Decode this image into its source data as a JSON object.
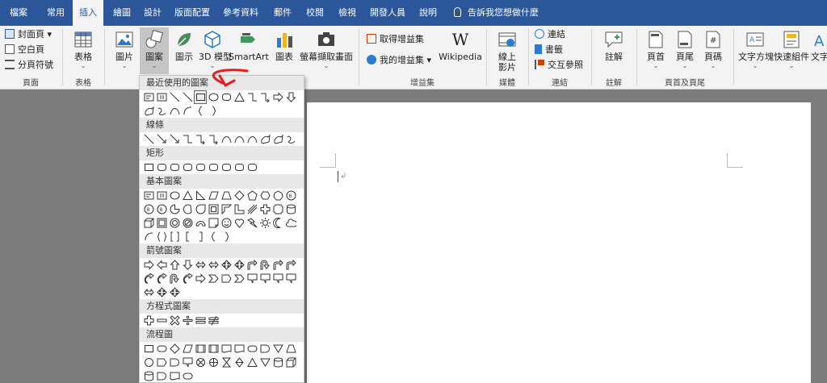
{
  "tabs": [
    "檔案",
    "常用",
    "插入",
    "繪圖",
    "設計",
    "版面配置",
    "參考資料",
    "郵件",
    "校閱",
    "檢視",
    "開發人員",
    "說明"
  ],
  "tell_me": "告訴我您想做什麼",
  "ribbon": {
    "pages": {
      "cover": "封面頁",
      "blank": "空白頁",
      "break": "分頁符號",
      "group": "頁面"
    },
    "table": {
      "label": "表格",
      "group": "表格"
    },
    "illustrations": {
      "picture": "圖片",
      "shapes": "圖案",
      "icons": "圖示",
      "model3d": "3D 模型",
      "smartart": "SmartArt",
      "chart": "圖表",
      "screenshot": "螢幕擷取畫面"
    },
    "addins": {
      "get": "取得增益集",
      "mine": "我的增益集",
      "wiki": "Wikipedia",
      "wiki_glyph": "W",
      "group": "增益集"
    },
    "media": {
      "video": "線上影片",
      "group": "媒體"
    },
    "links": {
      "link": "連結",
      "bookmark": "書籤",
      "xref": "交互參照",
      "group": "連結"
    },
    "comments": {
      "comment": "註解",
      "group": "註解"
    },
    "headerfooter": {
      "header": "頁首",
      "footer": "頁尾",
      "pagenum": "頁碼",
      "group": "頁首及頁尾"
    },
    "text": {
      "textbox": "文字方塊",
      "quickparts": "快速組件",
      "wordart": "文字"
    }
  },
  "shapes_menu": {
    "categories": [
      "最近使用的圖案",
      "線條",
      "矩形",
      "基本圖案",
      "箭號圖案",
      "方程式圖案",
      "流程圖"
    ]
  },
  "colors": {
    "accent": "#2b579a",
    "annotation": "#e02020"
  }
}
